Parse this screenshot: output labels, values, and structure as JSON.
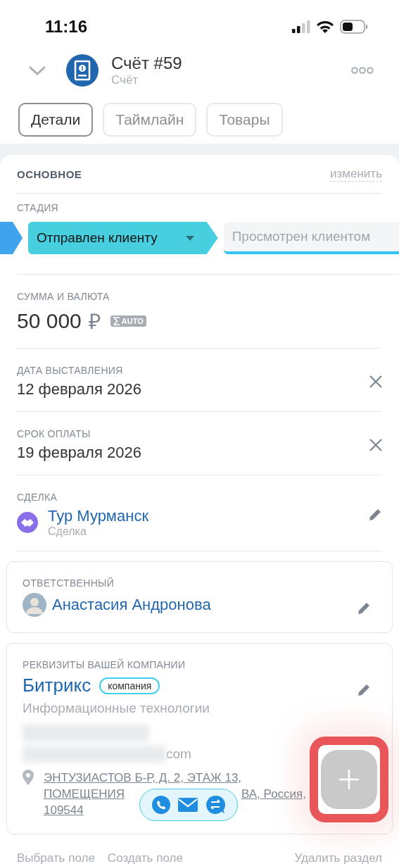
{
  "status_bar": {
    "time": "11:16"
  },
  "header": {
    "title": "Счёт #59",
    "subtitle": "Счёт"
  },
  "tabs": [
    {
      "label": "Детали",
      "selected": true
    },
    {
      "label": "Таймлайн",
      "selected": false
    },
    {
      "label": "Товары",
      "selected": false
    }
  ],
  "section": {
    "title": "ОСНОВНОЕ",
    "action": "изменить"
  },
  "stage": {
    "label": "СТАДИЯ",
    "stages": [
      {
        "kind": "past",
        "selected": false
      },
      {
        "kind": "current",
        "label": "Отправлен клиенту",
        "selected": true
      },
      {
        "kind": "next",
        "label": "Просмотрен клиентом",
        "selected": false
      }
    ]
  },
  "fields": [
    {
      "kind": "money",
      "label": "СУММА И ВАЛЮТА",
      "value": "50 000",
      "currency": "₽",
      "badge": "AUTO"
    },
    {
      "kind": "date",
      "label": "ДАТА ВЫСТАВЛЕНИЯ",
      "value": "12 февраля 2026"
    },
    {
      "kind": "date",
      "label": "СРОК ОПЛАТЫ",
      "value": "19 февраля 2026"
    },
    {
      "kind": "deal",
      "label": "СДЕЛКА",
      "value": "Тур Мурманск",
      "sub": "Сделка"
    }
  ],
  "responsible": {
    "label": "ОТВЕТСТВЕННЫЙ",
    "name": "Анастасия Андронова"
  },
  "company": {
    "label": "РЕКВИЗИТЫ ВАШЕЙ КОМПАНИИ",
    "name": "Битрикс",
    "tag": "компания",
    "industry": "Информационные технологии",
    "email_tail": "com",
    "address": [
      "ЭНТУЗИАСТОВ Б-Р, Д. 2, ЭТАЖ 13,",
      "ПОМЕЩЕНИЯ",
      "ВА, Россия,",
      "109544"
    ]
  },
  "footer": {
    "left": [
      "Выбрать поле",
      "Создать поле"
    ],
    "right": "Удалить раздел"
  }
}
